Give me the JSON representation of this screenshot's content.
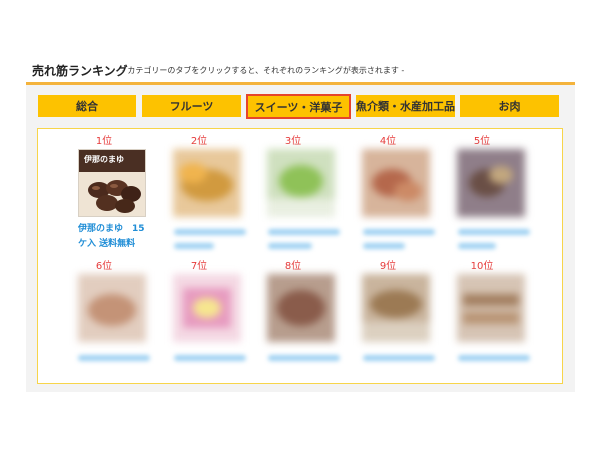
{
  "header": {
    "title": "売れ筋ランキング",
    "subtitle": "- カテゴリーのタブをクリックすると、それぞれのランキングが表示されます -"
  },
  "tabs": [
    {
      "label": "総合"
    },
    {
      "label": "フルーツ"
    },
    {
      "label": "スイーツ・洋菓子",
      "active": true
    },
    {
      "label": "魚介類・水産加工品"
    },
    {
      "label": "お肉"
    }
  ],
  "ranking": [
    {
      "rank": "1位",
      "name_line1": "伊那のまゆ　15",
      "name_line2": "ケ入 送料無料",
      "thumb_text": "伊那のまゆ"
    },
    {
      "rank": "2位"
    },
    {
      "rank": "3位"
    },
    {
      "rank": "4位"
    },
    {
      "rank": "5位"
    },
    {
      "rank": "6位"
    },
    {
      "rank": "7位"
    },
    {
      "rank": "8位"
    },
    {
      "rank": "9位"
    },
    {
      "rank": "10位"
    }
  ],
  "colors": {
    "accent_orange": "#f4b33c",
    "tab_yellow": "#fdc200",
    "active_border": "#e6452b",
    "rank_red": "#e63a3a",
    "link_blue": "#1f8dd6"
  }
}
